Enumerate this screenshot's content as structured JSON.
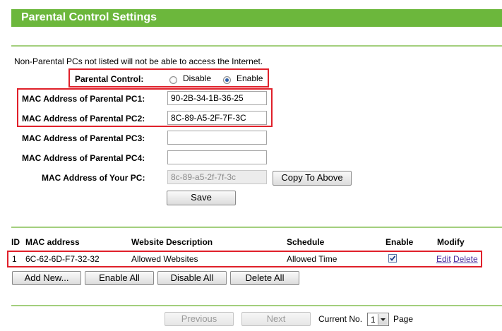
{
  "header": {
    "title": "Parental Control Settings"
  },
  "notice": "Non-Parental PCs not listed will not be able to access the Internet.",
  "parental_control": {
    "label": "Parental Control:",
    "options": [
      "Disable",
      "Enable"
    ],
    "selected": "Enable"
  },
  "fields": [
    {
      "label": "MAC Address of Parental PC1:",
      "value": "90-2B-34-1B-36-25"
    },
    {
      "label": "MAC Address of Parental PC2:",
      "value": "8C-89-A5-2F-7F-3C"
    },
    {
      "label": "MAC Address of Parental PC3:",
      "value": ""
    },
    {
      "label": "MAC Address of Parental PC4:",
      "value": ""
    }
  ],
  "your_pc": {
    "label": "MAC Address of Your PC:",
    "value": "8c-89-a5-2f-7f-3c"
  },
  "buttons": {
    "copy_to_above": "Copy To Above",
    "save": "Save",
    "add_new": "Add New...",
    "enable_all": "Enable All",
    "disable_all": "Disable All",
    "delete_all": "Delete All",
    "previous": "Previous",
    "next": "Next"
  },
  "table": {
    "headers": [
      "ID",
      "MAC address",
      "Website Description",
      "Schedule",
      "Enable",
      "Modify"
    ],
    "rows": [
      {
        "id": "1",
        "mac": "6C-62-6D-F7-32-32",
        "description": "Allowed Websites",
        "schedule": "Allowed Time",
        "enabled": true,
        "edit": "Edit",
        "delete": "Delete"
      }
    ]
  },
  "pagination": {
    "current_label": "Current No.",
    "current_value": "1",
    "page_label": "Page"
  },
  "colors": {
    "header_bg": "#6cb73c",
    "highlight_border": "#e0202a",
    "divider": "#a3cf7d",
    "link": "#4a2fa0"
  }
}
